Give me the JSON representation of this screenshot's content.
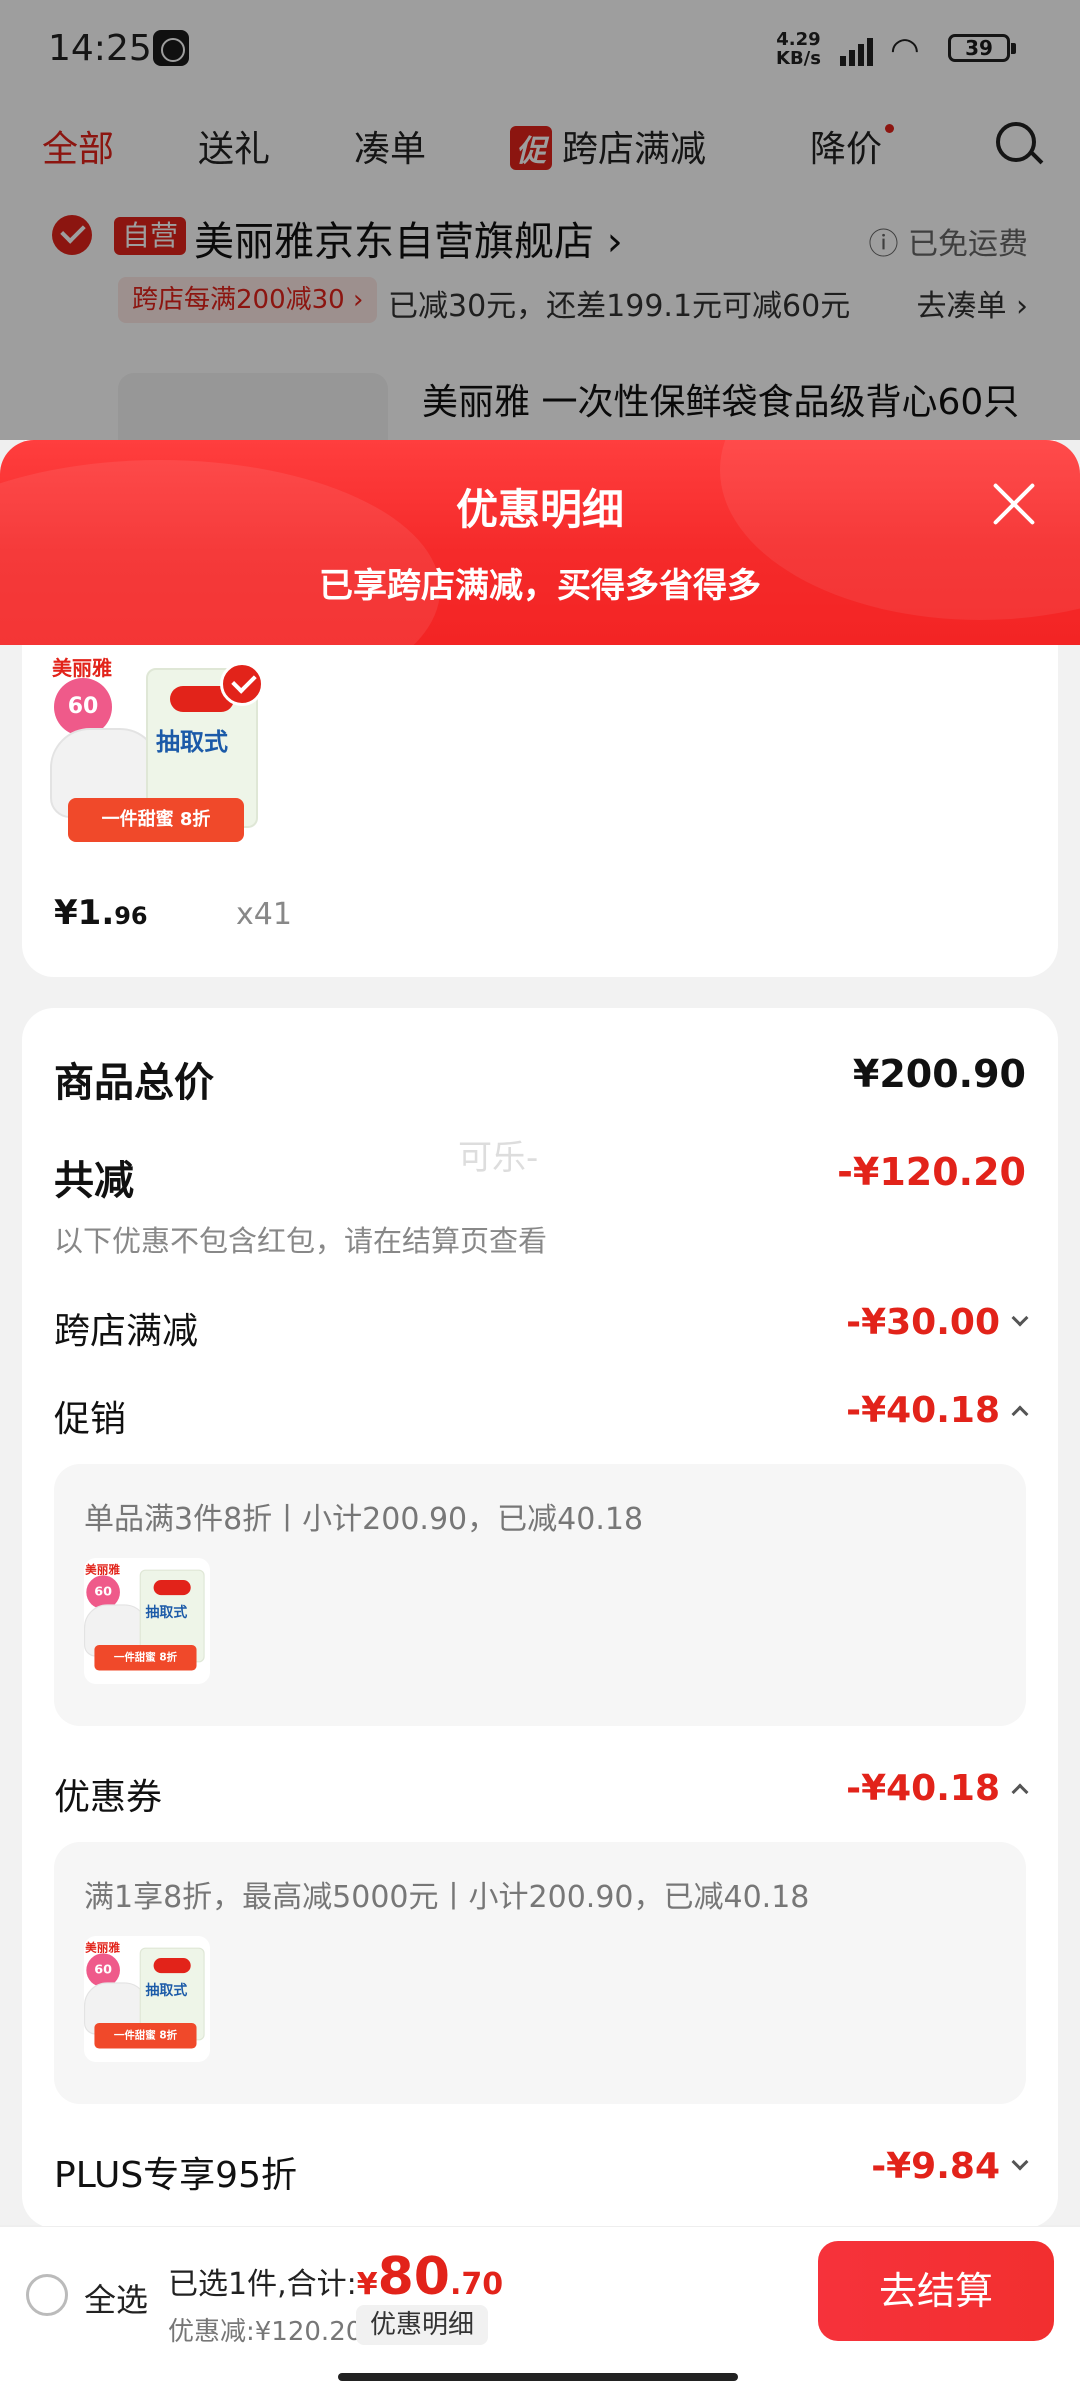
{
  "status_bar": {
    "time": "14:25",
    "net_speed_value": "4.29",
    "net_speed_unit": "KB/s",
    "battery": "39"
  },
  "tabs": [
    {
      "label": "全部",
      "active": true
    },
    {
      "label": "送礼"
    },
    {
      "label": "凑单"
    },
    {
      "label": "跨店满减",
      "badge": "促"
    },
    {
      "label": "降价"
    }
  ],
  "store": {
    "badge": "自营",
    "name": "美丽雅京东自营旗舰店 ›",
    "shipping": "ⓘ 已免运费",
    "promo_tag": "跨店每满200减30 ›",
    "promo_text": "已减30元，还差199.1元可减60元",
    "go_add": "去凑单 ›",
    "product_title": "美丽雅 一次性保鲜袋食品级背心60只"
  },
  "sheet": {
    "title": "优惠明细",
    "subtitle": "已享跨店满减，买得多省得多"
  },
  "product_art": {
    "brand": "美丽雅",
    "count": "60",
    "box_title": "抽取式",
    "ribbon": "一件甜蜜 8折"
  },
  "goods": {
    "price_int": "¥1.",
    "price_dec": "96",
    "qty": "x41"
  },
  "details": {
    "total_label": "商品总价",
    "total_amount": "¥200.90",
    "reduce_label": "共减",
    "reduce_amount": "-¥120.20",
    "note": "以下优惠不包含红包，请在结算页查看",
    "watermark": "可乐-",
    "rows": [
      {
        "label": "跨店满减",
        "amount": "-¥30.00"
      },
      {
        "label": "促销",
        "amount": "-¥40.18",
        "panel": "单品满3件8折丨小计200.90，已减40.18"
      },
      {
        "label": "优惠券",
        "amount": "-¥40.18",
        "panel": "满1享8折，最高减5000元丨小计200.90，已减40.18"
      },
      {
        "label": "PLUS专享95折",
        "amount": "-¥9.84"
      }
    ]
  },
  "bottom": {
    "select_all": "全选",
    "selected_text": "已选1件,合计:",
    "currency": "¥",
    "total_int": "80",
    "total_dec": ".70",
    "discount": "优惠减:¥120.20",
    "detail_chip": "优惠明细",
    "checkout": "去结算"
  },
  "colors": {
    "accent": "#e2231a",
    "header_red": "#f52a2a"
  }
}
